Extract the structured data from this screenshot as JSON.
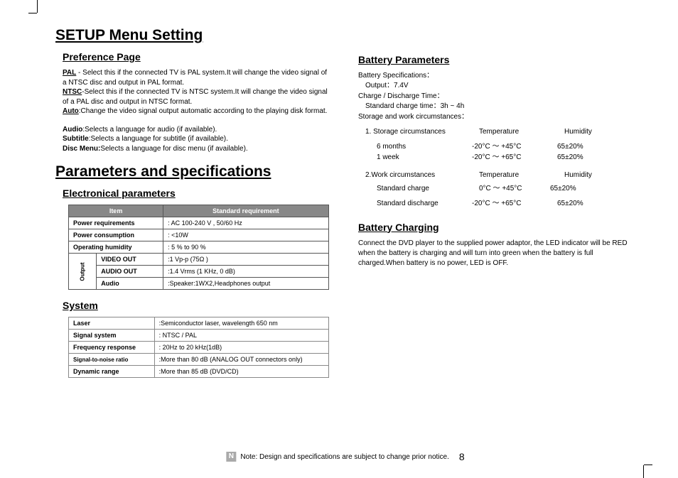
{
  "left": {
    "h1a": "SETUP Menu Setting",
    "h2a": "Preference Page",
    "pal_label": "PAL",
    "pal_text": " - Select this if the connected TV is PAL system.It will change the video signal of a NTSC disc and output in PAL format.",
    "ntsc_label": "NTSC",
    "ntsc_text": "-Select this if the connected TV is NTSC system.It will change the video signal of a PAL disc and output in NTSC format.",
    "auto_label": "Auto",
    "auto_text": ":Change the video signal output automatic according to the playing disk format.",
    "audio_label": "Audio",
    "audio_text": ":Selects a language for audio (if available).",
    "subtitle_label": "Subtitle",
    "subtitle_text": ":Selects a language for subtitle (if available).",
    "discmenu_label": "Disc Menu:",
    "discmenu_text": "Selects a language for disc menu (if available).",
    "h1b": "Parameters and specifications",
    "h2b": "Electronical parameters",
    "table_head_item": "Item",
    "table_head_req": "Standard requirement",
    "rows": [
      {
        "item": "Power requirements",
        "req": ": AC 100-240 V , 50/60 Hz"
      },
      {
        "item": "Power consumption",
        "req": ": <10W"
      },
      {
        "item": "Operating humidity",
        "req": ": 5 % to 90 %"
      }
    ],
    "output_label": "Output",
    "out_rows": [
      {
        "item": "VIDEO OUT",
        "req": ":1 Vp-p (75Ω )"
      },
      {
        "item": "AUDIO OUT",
        "req": ":1.4 Vrms (1 KHz, 0 dB)"
      },
      {
        "item": "Audio",
        "req": ":Speaker:1WX2,Headphones output"
      }
    ],
    "h2c": "System",
    "sys_rows": [
      {
        "lbl": "Laser",
        "val": ":Semiconductor laser, wavelength 650 nm"
      },
      {
        "lbl": "Signal system",
        "val": ": NTSC / PAL"
      },
      {
        "lbl": "Frequency response",
        "val": ": 20Hz to 20 kHz(1dB)"
      },
      {
        "lbl": "Signal-to-noise ratio",
        "val": ":More than 80 dB (ANALOG OUT connectors only)"
      },
      {
        "lbl": "Dynamic range",
        "val": ":More than 85 dB (DVD/CD)"
      }
    ],
    "note_n": "N",
    "note_text": "Note: Design and specifications are subject to change prior notice.",
    "page_num": "8"
  },
  "right": {
    "h2a": "Battery Parameters",
    "spec_label": "Battery Specifications：",
    "spec_output": "Output：7.4V",
    "charge_label": "Charge / Discharge Time：",
    "charge_time": "Standard charge time：3h ~ 4h",
    "storage_label": "Storage and work circumstances：",
    "sec1_head": {
      "c1": "1. Storage circumstances",
      "c2": "Temperature",
      "c3": "Humidity"
    },
    "sec1_rows": [
      {
        "c1": "6 months",
        "c2": "-20°C ～ +45°C",
        "c3": "65±20%"
      },
      {
        "c1": "1 week",
        "c2": "-20°C ～ +65°C",
        "c3": "65±20%"
      }
    ],
    "sec2_head": {
      "c1": "2.Work circumstances",
      "c2": "Temperature",
      "c3": "Humidity"
    },
    "sec2_rows": [
      {
        "c1": "Standard charge",
        "c2": "0°C ～ +45°C",
        "c3": "65±20%"
      },
      {
        "c1": "Standard discharge",
        "c2": "-20°C ～ +65°C",
        "c3": "65±20%"
      }
    ],
    "h2b": "Battery Charging",
    "charging_text": "Connect the DVD player to the supplied power adaptor, the LED indicator will be RED when the battery is charging and will turn into green when the battery is full charged.When battery is no power, LED is OFF."
  }
}
